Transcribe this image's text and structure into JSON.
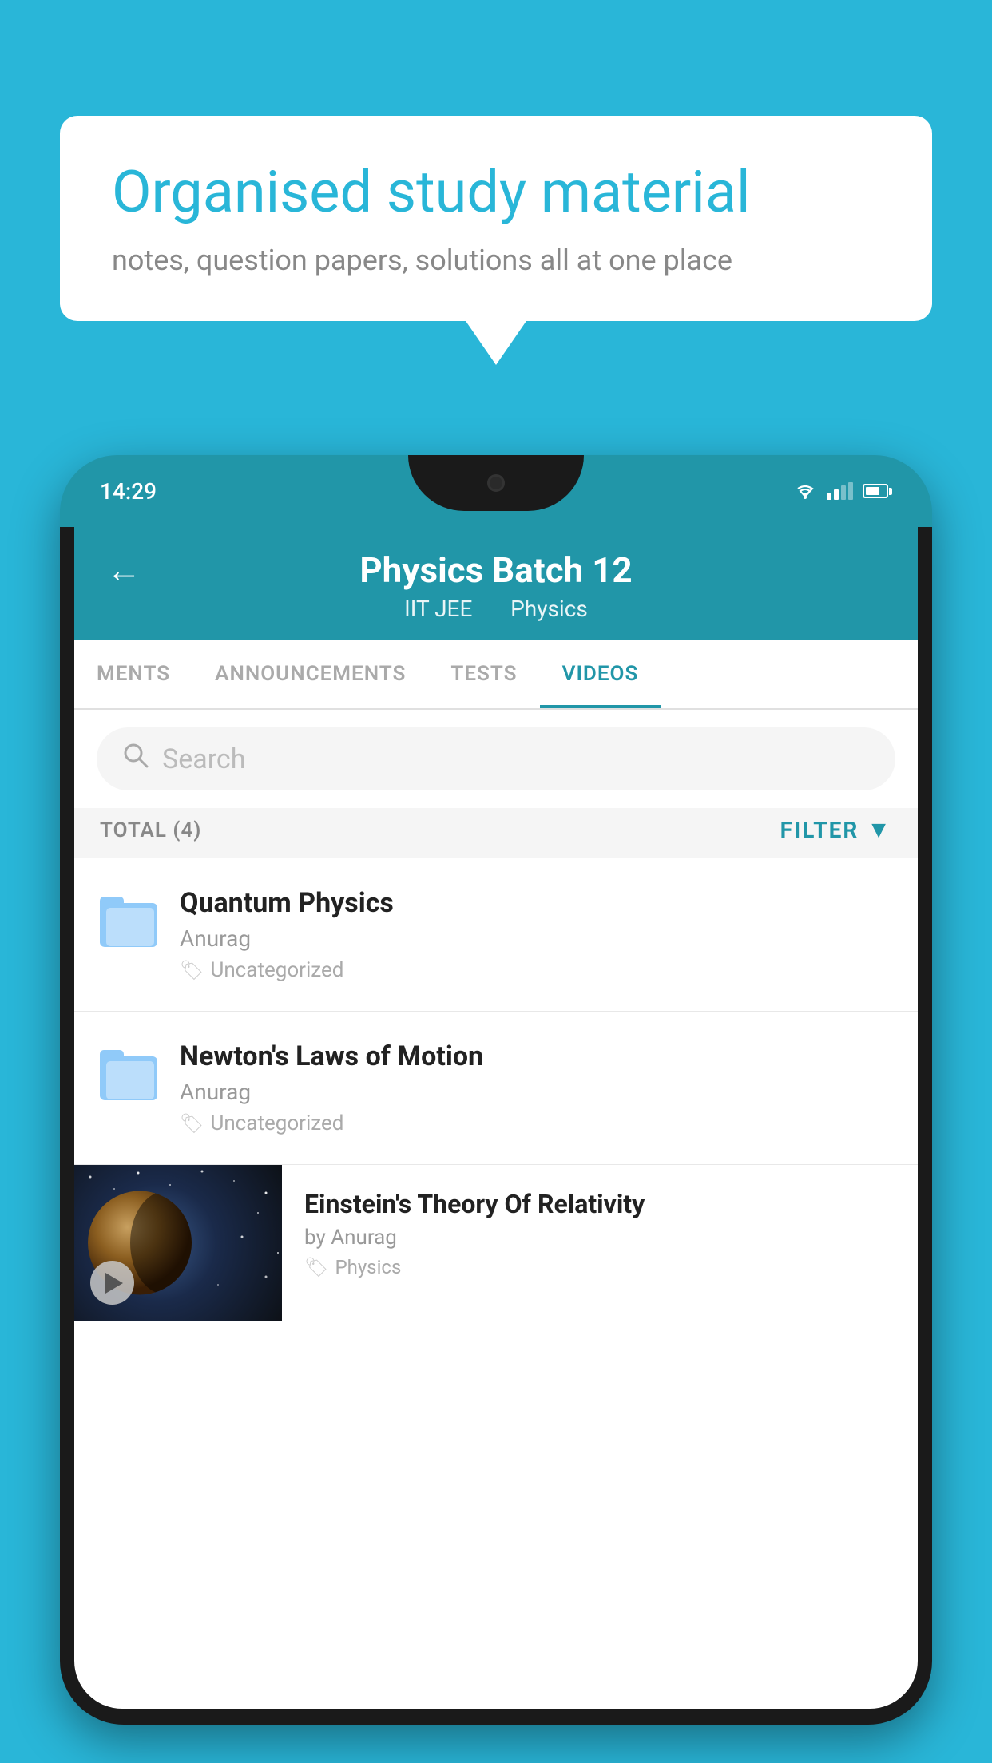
{
  "background_color": "#29b6d8",
  "bubble": {
    "title": "Organised study material",
    "subtitle": "notes, question papers, solutions all at one place"
  },
  "phone": {
    "status_time": "14:29",
    "header": {
      "title": "Physics Batch 12",
      "subtitle_part1": "IIT JEE",
      "subtitle_part2": "Physics",
      "back_label": "←"
    },
    "tabs": [
      {
        "label": "MENTS",
        "active": false
      },
      {
        "label": "ANNOUNCEMENTS",
        "active": false
      },
      {
        "label": "TESTS",
        "active": false
      },
      {
        "label": "VIDEOS",
        "active": true
      }
    ],
    "search": {
      "placeholder": "Search"
    },
    "filter": {
      "total_label": "TOTAL (4)",
      "filter_label": "FILTER"
    },
    "videos": [
      {
        "title": "Quantum Physics",
        "author": "Anurag",
        "tag": "Uncategorized",
        "has_thumb": false
      },
      {
        "title": "Newton's Laws of Motion",
        "author": "Anurag",
        "tag": "Uncategorized",
        "has_thumb": false
      },
      {
        "title": "Einstein's Theory Of Relativity",
        "author": "by Anurag",
        "tag": "Physics",
        "has_thumb": true
      }
    ]
  }
}
